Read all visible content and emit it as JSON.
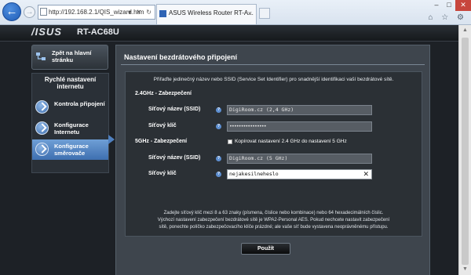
{
  "browser": {
    "url": "http://192.168.2.1/QIS_wizard.htm",
    "tab_title": "ASUS Wireless Router RT-A...",
    "tab_close": "×",
    "addr_icons": "▾ ✕ ↻",
    "window_buttons": [
      "–",
      "□",
      "✕"
    ],
    "tool_icons": "⌂ ☆ ⚙"
  },
  "header": {
    "brand": "/ISUS",
    "model": "RT-AC68U"
  },
  "sidebar": {
    "home_label": "Zpět na hlavní stránku",
    "wizard_title": "Rychlé nastavení internetu",
    "steps": [
      {
        "label": "Kontrola připojení",
        "active": false
      },
      {
        "label": "Konfigurace Internetu",
        "active": false
      },
      {
        "label": "Konfigurace směrovače",
        "active": true
      }
    ]
  },
  "main": {
    "title": "Nastavení bezdrátového připojení",
    "intro": "Přiřaďte jedinečný název nebo SSID (Service Set Identifier) pro snadnější identifikaci vaší bezdrátové sítě.",
    "band24": {
      "heading": "2.4GHz - Zabezpečení",
      "ssid_label": "Síťový název (SSID)",
      "ssid_value": "DigiRoom.cz (2,4 GHz)",
      "key_label": "Síťový klíč",
      "key_value": "••••••••••••••••"
    },
    "band5": {
      "heading": "5GHz - Zabezpečení",
      "copy_checkbox_label": "Kopírovat nastavení 2.4 GHz do nastavení 5 GHz",
      "ssid_label": "Síťový název (SSID)",
      "ssid_value": "DigiRoom.cz (5 GHz)",
      "key_label": "Síťový klíč",
      "key_value": "nejakesilneheslo"
    },
    "help_icon": "?",
    "clear_icon": "✕",
    "note_lines": [
      "Zadejte síťový klíč mezi 8 a 63 znaky (písmena, číslice nebo kombinace) nebo 64 hexadecimálních číslic.",
      "Výchozí nastavení zabezpečení bezdrátové sítě je WPA2-Personal AES. Pokud nechcete nastavit zabezpečení",
      "sítě, ponechte políčko zabezpečovacího klíče prázdné; ale vaše síť bude vystavena neoprávněnému přístupu."
    ],
    "apply_label": "Použít"
  },
  "colors": {
    "accent": "#4f80bf",
    "page_bg": "#1d2126",
    "panel_bg": "#3e454d"
  }
}
